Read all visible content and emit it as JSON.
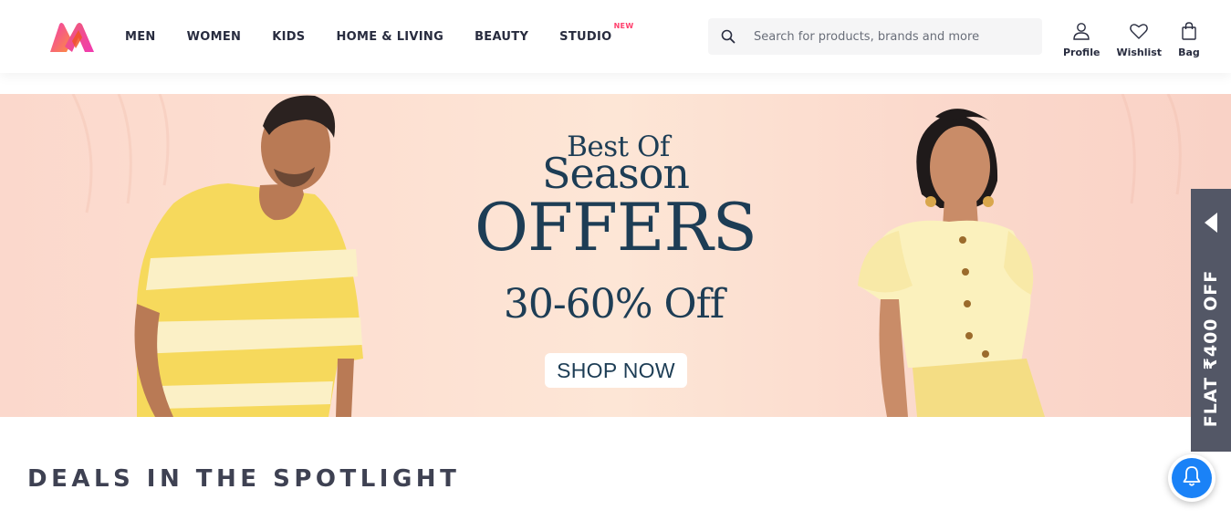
{
  "header": {
    "logo_icon": "myntra-logo",
    "nav": [
      {
        "label": "MEN"
      },
      {
        "label": "WOMEN"
      },
      {
        "label": "KIDS"
      },
      {
        "label": "HOME & LIVING"
      },
      {
        "label": "BEAUTY"
      },
      {
        "label": "STUDIO",
        "badge": "NEW"
      }
    ],
    "search": {
      "placeholder": "Search for products, brands and more",
      "icon": "search-icon"
    },
    "actions": [
      {
        "label": "Profile",
        "icon": "person-icon"
      },
      {
        "label": "Wishlist",
        "icon": "heart-icon"
      },
      {
        "label": "Bag",
        "icon": "bag-icon"
      }
    ]
  },
  "banner": {
    "line1": "Best Of",
    "line2": "Season",
    "line3": "OFFERS",
    "line4": "30-60% Off",
    "cta": "SHOP NOW"
  },
  "side_offer": {
    "label": "FLAT ₹400 OFF",
    "icon": "arrow-left-icon"
  },
  "section": {
    "title": "DEALS IN THE SPOTLIGHT"
  },
  "notification": {
    "icon": "bell-icon"
  },
  "colors": {
    "brand_pink": "#ff3f6c",
    "text_dark": "#282c3f",
    "banner_text": "#1d3d55",
    "tab_bg": "#535766",
    "bell_blue": "#1a82f7"
  }
}
